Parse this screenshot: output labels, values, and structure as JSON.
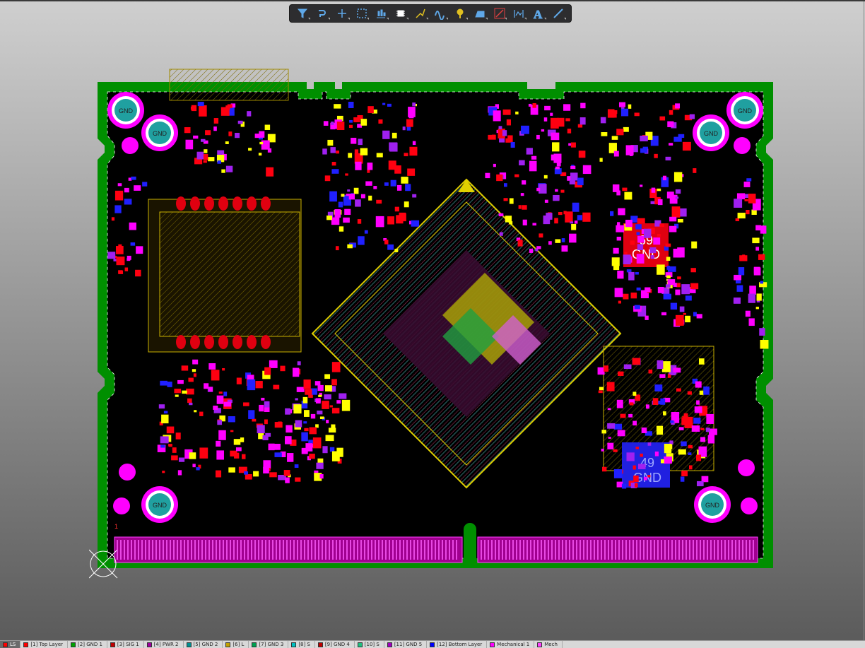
{
  "toolbar": {
    "tools": [
      {
        "icon": "filter-icon",
        "color": "#5fa8e8"
      },
      {
        "icon": "interactive-route-icon",
        "color": "#5fa8e8"
      },
      {
        "icon": "place-component-icon",
        "color": "#5fa8e8"
      },
      {
        "icon": "select-rectangle-icon",
        "color": "#5fa8e8"
      },
      {
        "icon": "align-icon",
        "color": "#5fa8e8"
      },
      {
        "icon": "place-chip-icon",
        "color": "#ffffff"
      },
      {
        "icon": "route-multiple-icon",
        "color": "#e0c020"
      },
      {
        "icon": "diff-pair-icon",
        "color": "#5fa8e8"
      },
      {
        "icon": "place-via-icon",
        "color": "#e0c020"
      },
      {
        "icon": "polygon-pour-icon",
        "color": "#5fa8e8"
      },
      {
        "icon": "place-line-icon",
        "color": "#e04040"
      },
      {
        "icon": "dimension-icon",
        "color": "#5fa8e8"
      },
      {
        "icon": "place-string-icon",
        "color": "#5fa8e8"
      },
      {
        "icon": "place-track-icon",
        "color": "#5fa8e8"
      }
    ]
  },
  "board": {
    "labels": {
      "gnd_pad_1_net": "69",
      "gnd_pad_1_name": "GND",
      "gnd_pad_2_net": "49",
      "gnd_pad_2_name": "GND",
      "corner_pin_1": "1",
      "hole_label": "GND"
    },
    "colors": {
      "board_edge": "#009900",
      "background": "#000000",
      "top_layer": "#ff0000",
      "bottom_layer": "#0000ff",
      "overlay": "#ffff00",
      "pads": "#ff00ff",
      "vias": "#c8a000"
    }
  },
  "layer_tabs": [
    {
      "label": "LS",
      "color": "#ff0000",
      "active": true
    },
    {
      "label": "[1] Top Layer",
      "color": "#ff0000"
    },
    {
      "label": "[2] GND 1",
      "color": "#00a000"
    },
    {
      "label": "[3] SIG 1",
      "color": "#c00000"
    },
    {
      "label": "[4] PWR 2",
      "color": "#a000a0"
    },
    {
      "label": "[5] GND 2",
      "color": "#009090"
    },
    {
      "label": "[6] L",
      "color": "#c0a000"
    },
    {
      "label": "[7] GND 3",
      "color": "#00a050"
    },
    {
      "label": "[8] S",
      "color": "#00c0c0"
    },
    {
      "label": "[9] GND 4",
      "color": "#c00000"
    },
    {
      "label": "[10] S",
      "color": "#20c080"
    },
    {
      "label": "[11] GND 5",
      "color": "#a000c0"
    },
    {
      "label": "[12] Bottom Layer",
      "color": "#0000ff"
    },
    {
      "label": "Mechanical 1",
      "color": "#ff00ff"
    },
    {
      "label": "Mech",
      "color": "#ff40ff"
    }
  ]
}
